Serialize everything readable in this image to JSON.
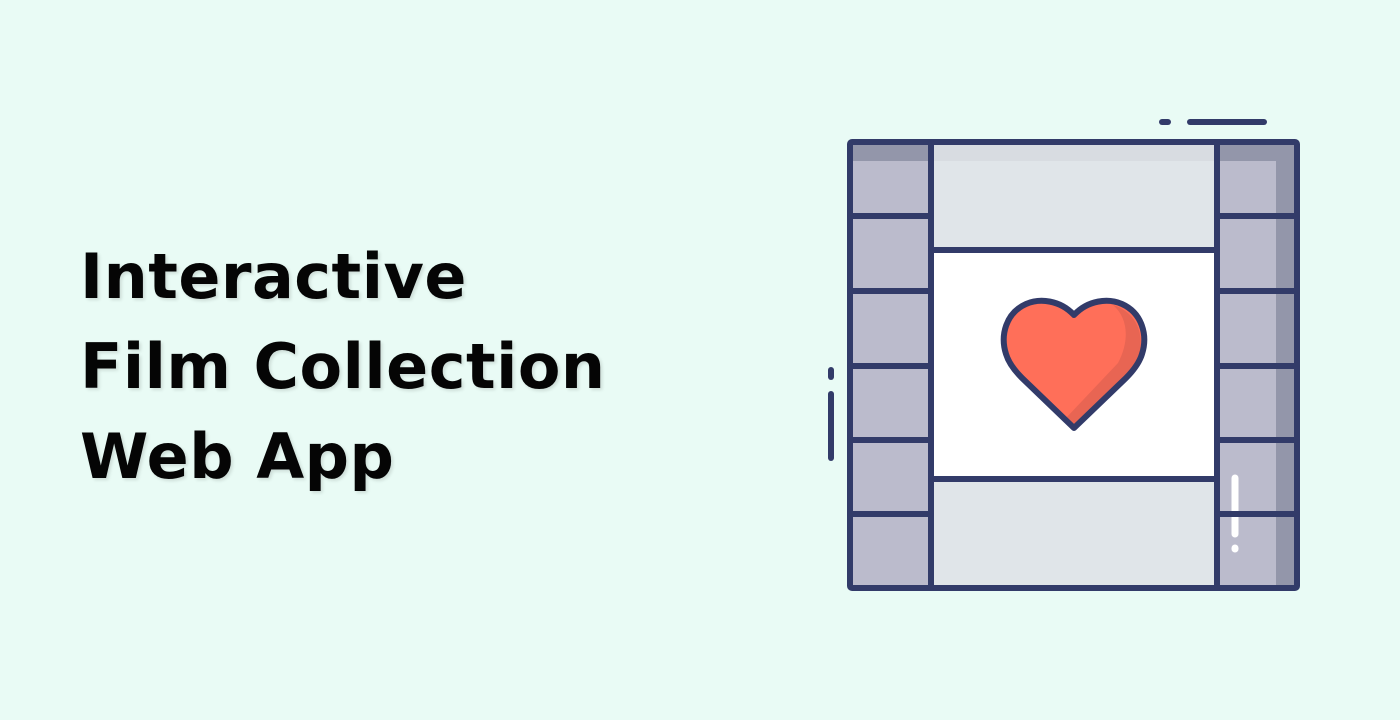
{
  "title": {
    "lines": [
      "Interactive",
      "Film Collection",
      "Web App"
    ]
  },
  "illustration": {
    "icon": "film-strip-heart-icon",
    "colors": {
      "background": "#e9fbf5",
      "outline": "#323b69",
      "sprocket": "#bbbbcc",
      "sprocket_shade": "#9396aa",
      "frame_light": "#e0e5e9",
      "heart": "#ff6f59",
      "heart_shade": "#e86553"
    }
  }
}
